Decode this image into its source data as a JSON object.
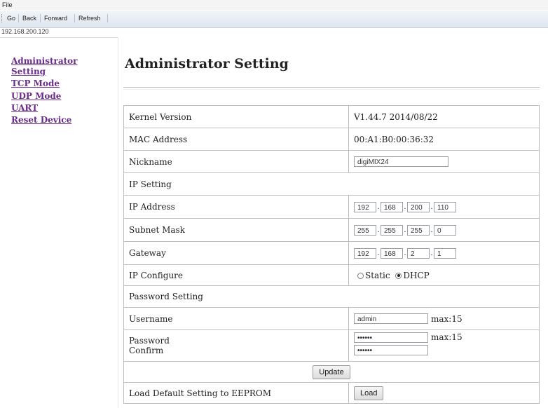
{
  "menu": {
    "file": "File"
  },
  "toolbar": {
    "go": "Go",
    "back": "Back",
    "forward": "Forward",
    "refresh": "Refresh"
  },
  "address": "192.168.200.120",
  "nav": {
    "administrator": "Administrator",
    "setting": "Setting",
    "tcp_mode": "TCP Mode",
    "udp_mode": "UDP Mode",
    "uart": "UART",
    "reset_device": "Reset Device"
  },
  "page_title": "Administrator Setting",
  "table": {
    "kernel_version_label": "Kernel Version",
    "kernel_version_value": "V1.44.7 2014/08/22",
    "mac_label": "MAC Address",
    "mac_value": "00:A1:B0:00:36:32",
    "nickname_label": "Nickname",
    "nickname_value": "digiMIX24",
    "ip_setting_header": "IP Setting",
    "ip_address_label": "IP Address",
    "ip_address": [
      "192",
      "168",
      "200",
      "110"
    ],
    "subnet_label": "Subnet Mask",
    "subnet": [
      "255",
      "255",
      "255",
      "0"
    ],
    "gateway_label": "Gateway",
    "gateway": [
      "192",
      "168",
      "2",
      "1"
    ],
    "ip_configure_label": "IP Configure",
    "ip_configure_static": "Static",
    "ip_configure_dhcp": "DHCP",
    "ip_configure_selected": "DHCP",
    "password_setting_header": "Password Setting",
    "username_label": "Username",
    "username_value": "admin",
    "username_max": "max:15",
    "password_label": "Password",
    "confirm_label": "Confirm",
    "password_mask": "••••••",
    "confirm_mask": "••••••",
    "password_max": "max:15",
    "update_button": "Update",
    "load_default_label": "Load Default Setting to EEPROM",
    "load_button": "Load"
  }
}
